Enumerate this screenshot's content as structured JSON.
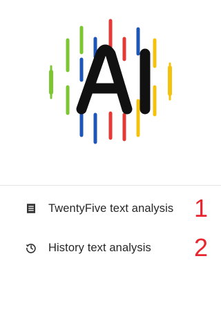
{
  "logo": {
    "text": "AI",
    "colors": {
      "red": "#e53935",
      "blue": "#1e56b8",
      "green": "#7cc631",
      "yellow": "#f4c20d",
      "black": "#111111"
    }
  },
  "menu": {
    "items": [
      {
        "label": "TwentyFive text analysis",
        "icon": "document-list-icon",
        "number": "1"
      },
      {
        "label": "History text analysis",
        "icon": "history-clock-icon",
        "number": "2"
      }
    ]
  },
  "accent_color": "#e8242c"
}
